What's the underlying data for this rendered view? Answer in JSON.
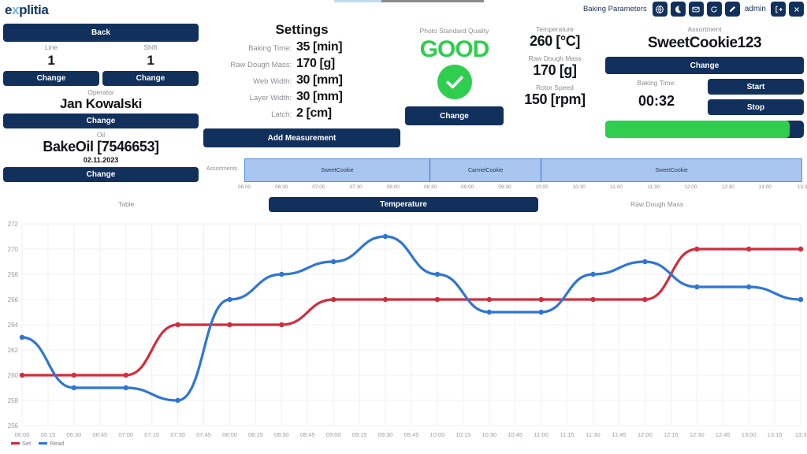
{
  "header": {
    "logo_text_1": "e",
    "logo_text_x": "x",
    "logo_text_2": "plitia",
    "title": "Baking Parameters",
    "user": "admin",
    "icons": [
      {
        "name": "globe-icon",
        "glyph": "⊕"
      },
      {
        "name": "moon-icon",
        "glyph": "☾"
      },
      {
        "name": "mail-icon",
        "glyph": "✉"
      },
      {
        "name": "refresh-icon",
        "glyph": "↻"
      },
      {
        "name": "pencil-icon",
        "glyph": "✎"
      },
      {
        "name": "logout-icon",
        "glyph": "⇥"
      },
      {
        "name": "close-icon",
        "glyph": "✕"
      }
    ]
  },
  "left": {
    "back_label": "Back",
    "line_caption": "Line",
    "line_value": "1",
    "line_change": "Change",
    "shift_caption": "Shift",
    "shift_value": "1",
    "shift_change": "Change",
    "operator_caption": "Operator",
    "operator_value": "Jan Kowalski",
    "operator_change": "Change",
    "oil_caption": "Oil",
    "oil_value": "BakeOil [7546653]",
    "oil_date": "02.11.2023",
    "oil_change": "Change"
  },
  "settings": {
    "title": "Settings",
    "rows": [
      {
        "label": "Baking Time:",
        "value": "35 [min]"
      },
      {
        "label": "Raw Dough Mass:",
        "value": "170 [g]"
      },
      {
        "label": "Web Width:",
        "value": "30 [mm]"
      },
      {
        "label": "Layer Width:",
        "value": "30 [mm]"
      },
      {
        "label": "Latch:",
        "value": "2 [cm]"
      }
    ],
    "add_measurement": "Add Measurement"
  },
  "quality": {
    "caption": "Photo Standard Quality",
    "status": "GOOD",
    "status_color": "#2fce4f",
    "change_label": "Change"
  },
  "measures": [
    {
      "caption": "Temperature",
      "value": "260 [°C]"
    },
    {
      "caption": "Raw Dough Mass",
      "value": "170 [g]"
    },
    {
      "caption": "Rotor Speed",
      "value": "150 [rpm]"
    }
  ],
  "assortment": {
    "caption": "Assortment",
    "value": "SweetCookie123",
    "change_label": "Change",
    "baking_time_caption": "Baking Time:",
    "baking_time_value": "00:32",
    "start_label": "Start",
    "stop_label": "Stop",
    "progress_percent": 93,
    "progress_color": "#2fce4f"
  },
  "timeline": {
    "label": "Assortments",
    "segments": [
      {
        "name": "SweetCookie",
        "start": "06:00",
        "end": "08:30",
        "width_pct": 33.3
      },
      {
        "name": "CarmelCookie",
        "start": "08:30",
        "end": "10:00",
        "width_pct": 20.0
      },
      {
        "name": "SweetCookie",
        "start": "10:00",
        "end": "13:30",
        "width_pct": 46.7
      }
    ],
    "ticks": [
      "06:00",
      "06:30",
      "07:00",
      "07:30",
      "08:00",
      "08:30",
      "09:00",
      "09:30",
      "10:00",
      "10:30",
      "11:00",
      "11:30",
      "12:00",
      "12:30",
      "13:00",
      "13:3"
    ]
  },
  "tabs": {
    "table": "Table",
    "temperature": "Temperature",
    "raw_dough_mass": "Raw Dough Mass"
  },
  "chart_data": {
    "type": "line",
    "title": "Temperature",
    "xlabel": "",
    "ylabel": "",
    "ylim": [
      256,
      272
    ],
    "yticks": [
      256,
      258,
      260,
      262,
      264,
      266,
      268,
      270,
      272
    ],
    "grid": true,
    "legend_position": "bottom-left",
    "x": [
      "06:00",
      "06:15",
      "06:30",
      "06:45",
      "07:00",
      "07:15",
      "07:30",
      "07:45",
      "08:00",
      "08:15",
      "08:30",
      "08:45",
      "09:00",
      "09:15",
      "09:30",
      "09:45",
      "10:00",
      "10:15",
      "10:30",
      "10:45",
      "11:00",
      "11:15",
      "11:30",
      "11:45",
      "12:00",
      "12:15",
      "12:30",
      "12:45",
      "13:00",
      "13:15",
      "13:30"
    ],
    "xticks": [
      "06:00",
      "06:15",
      "06:30",
      "06:45",
      "07:00",
      "07:15",
      "07:30",
      "07:45",
      "08:00",
      "08:15",
      "08:30",
      "08:45",
      "09:00",
      "09:15",
      "09:30",
      "09:45",
      "10:00",
      "10:15",
      "10:30",
      "10:45",
      "11:00",
      "11:15",
      "11:30",
      "11:45",
      "12:00",
      "12:15",
      "12:30",
      "12:45",
      "13:00",
      "13:15",
      "13:3"
    ],
    "marker_x": [
      "06:00",
      "06:30",
      "07:00",
      "07:30",
      "08:00",
      "08:30",
      "09:00",
      "09:30",
      "10:00",
      "10:30",
      "11:00",
      "11:30",
      "12:00",
      "12:30",
      "13:00",
      "13:30"
    ],
    "series": [
      {
        "name": "Set",
        "color": "#d22d3d",
        "values": [
          260,
          260,
          260,
          264,
          264,
          264,
          266,
          266,
          266,
          266,
          266,
          266,
          266,
          270,
          270,
          270
        ]
      },
      {
        "name": "Read",
        "color": "#2f76d2",
        "values": [
          263,
          259,
          259,
          258,
          266,
          268,
          269,
          271,
          268,
          265,
          265,
          268,
          269,
          267,
          267,
          266
        ]
      }
    ]
  }
}
